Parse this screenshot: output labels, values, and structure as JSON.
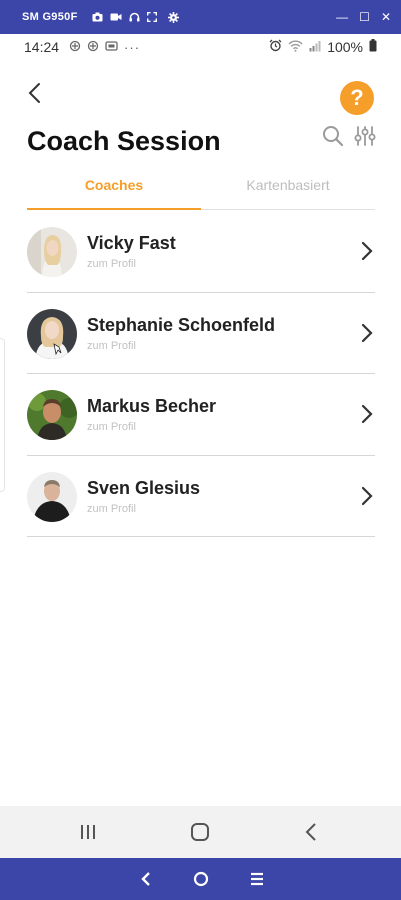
{
  "window": {
    "title": "SM G950F",
    "icons": [
      "camera-icon",
      "video-icon",
      "headset-icon",
      "fullscreen-icon",
      "settings-icon"
    ],
    "controls": {
      "minimize": "—",
      "maximize": "☐",
      "close": "✕"
    },
    "accent_color": "#3c45a8"
  },
  "status_bar": {
    "time": "14:24",
    "left_icons": [
      "app-icon",
      "app-icon",
      "app-icon",
      "more-dots-icon"
    ],
    "right_icons": [
      "alarm-icon",
      "wifi-icon",
      "signal-icon",
      "battery-icon"
    ],
    "battery": "100%"
  },
  "header": {
    "title": "Coach Session",
    "help_label": "?",
    "help_color": "#f59e2a"
  },
  "tabs": [
    {
      "label": "Coaches",
      "active": true
    },
    {
      "label": "Kartenbasiert",
      "active": false
    }
  ],
  "coaches": [
    {
      "name": "Vicky Fast",
      "subtitle": "zum Profil"
    },
    {
      "name": "Stephanie Schoenfeld",
      "subtitle": "zum Profil"
    },
    {
      "name": "Markus Becher",
      "subtitle": "zum Profil"
    },
    {
      "name": "Sven Glesius",
      "subtitle": "zum Profil"
    }
  ],
  "android_nav": [
    "recent-apps-icon",
    "home-icon",
    "back-icon"
  ],
  "mirror_nav": [
    "back-icon",
    "home-icon",
    "menu-icon"
  ]
}
